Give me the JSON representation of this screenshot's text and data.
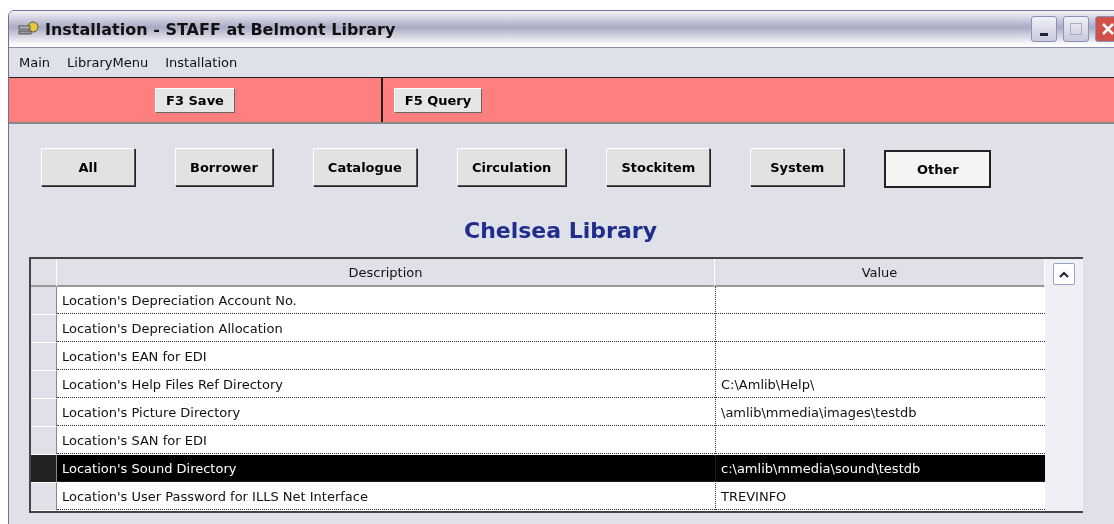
{
  "window": {
    "title": "Installation - STAFF at Belmont Library"
  },
  "menu": [
    "Main",
    "LibraryMenu",
    "Installation"
  ],
  "toolbar": [
    "F3 Save",
    "F5 Query"
  ],
  "filters": [
    {
      "label": "All",
      "selected": false
    },
    {
      "label": "Borrower",
      "selected": false
    },
    {
      "label": "Catalogue",
      "selected": false
    },
    {
      "label": "Circulation",
      "selected": false
    },
    {
      "label": "Stockitem",
      "selected": false
    },
    {
      "label": "System",
      "selected": false
    },
    {
      "label": "Other",
      "selected": true
    }
  ],
  "heading": "Chelsea Library",
  "table": {
    "columns": [
      "Description",
      "Value"
    ],
    "rows": [
      {
        "description": "Location's Depreciation Account No.",
        "value": "",
        "selected": false
      },
      {
        "description": "Location's Depreciation Allocation",
        "value": "",
        "selected": false
      },
      {
        "description": "Location's EAN for EDI",
        "value": "",
        "selected": false
      },
      {
        "description": "Location's Help Files Ref Directory",
        "value": "C:\\Amlib\\Help\\",
        "selected": false
      },
      {
        "description": "Location's Picture Directory",
        "value": "\\amlib\\mmedia\\images\\testdb",
        "selected": false
      },
      {
        "description": "Location's SAN for EDI",
        "value": "",
        "selected": false
      },
      {
        "description": "Location's Sound Directory",
        "value": "c:\\amlib\\mmedia\\sound\\testdb",
        "selected": true
      },
      {
        "description": "Location's User Password for ILLS Net Interface",
        "value": "TREVINFO",
        "selected": false
      }
    ]
  }
}
